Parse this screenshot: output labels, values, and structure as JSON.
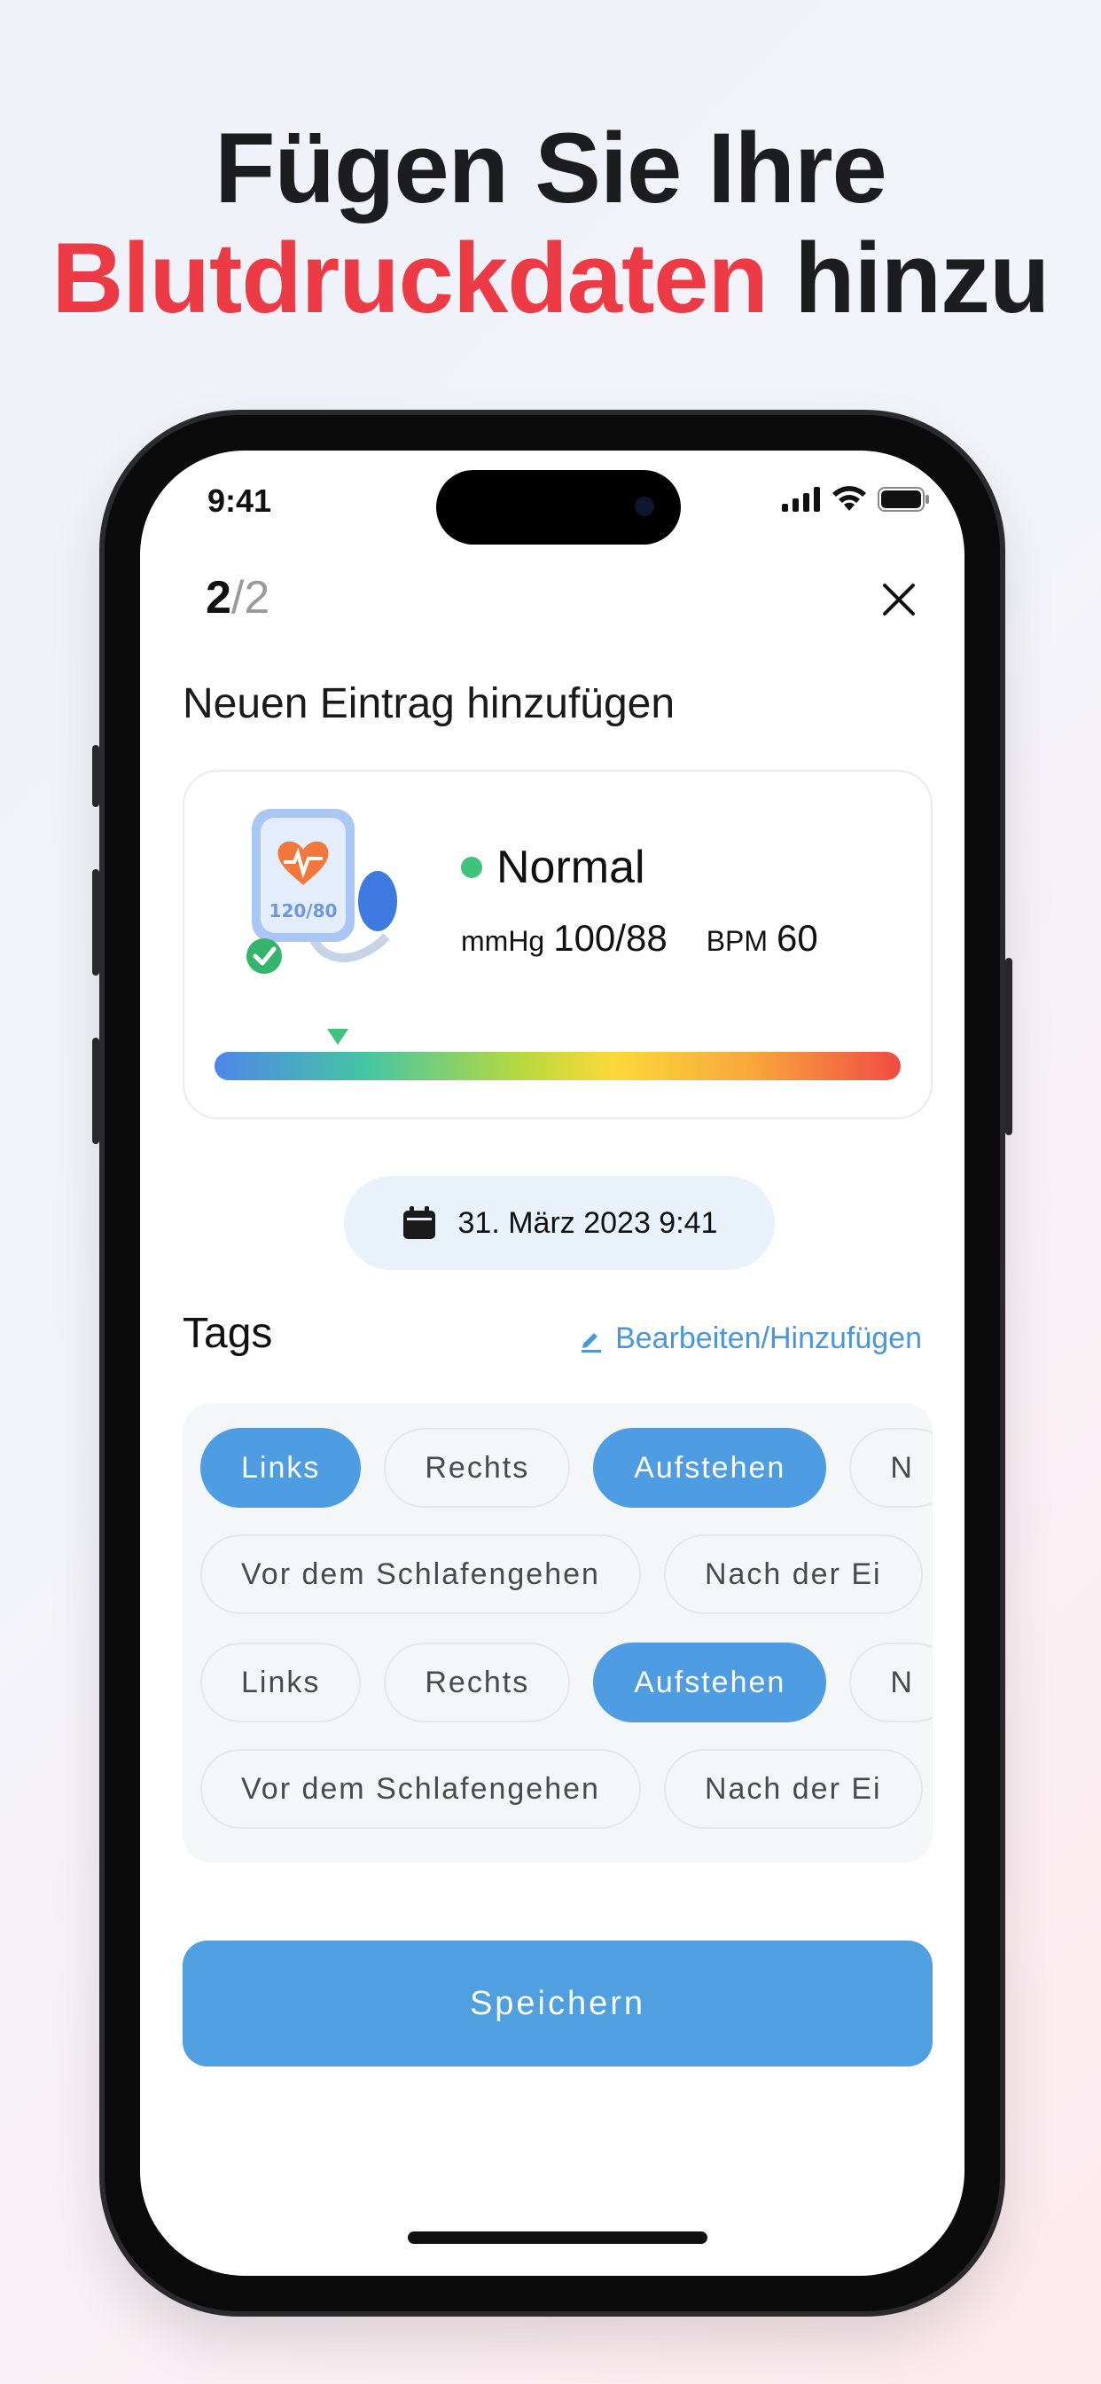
{
  "headline": {
    "line1": "Fügen Sie Ihre",
    "line2_accent": "Blutdruckdaten",
    "line2_rest": "hinzu"
  },
  "status_bar": {
    "time": "9:41"
  },
  "step": {
    "current": "2",
    "separator": "/",
    "total": "2"
  },
  "title": "Neuen Eintrag hinzufügen",
  "reading": {
    "status": "Normal",
    "pressure_unit": "mmHg",
    "pressure_value": "100/88",
    "pulse_unit": "BPM",
    "pulse_value": "60",
    "device_display": "120/80",
    "range_position": 0.18,
    "status_color": "#3fc47f"
  },
  "date": "31. März 2023 9:41",
  "tags": {
    "title": "Tags",
    "edit_label": "Bearbeiten/Hinzufügen",
    "rows": [
      [
        {
          "label": "Links",
          "selected": true
        },
        {
          "label": "Rechts",
          "selected": false
        },
        {
          "label": "Aufstehen",
          "selected": true
        },
        {
          "label": "N",
          "selected": false
        }
      ],
      [
        {
          "label": "Vor dem Schlafengehen",
          "selected": false
        },
        {
          "label": "Nach der Ei",
          "selected": false
        }
      ],
      [
        {
          "label": "Links",
          "selected": false
        },
        {
          "label": "Rechts",
          "selected": false
        },
        {
          "label": "Aufstehen",
          "selected": true
        },
        {
          "label": "N",
          "selected": false
        }
      ],
      [
        {
          "label": "Vor dem Schlafengehen",
          "selected": false
        },
        {
          "label": "Nach der Ei",
          "selected": false
        }
      ]
    ]
  },
  "save_label": "Speichern",
  "colors": {
    "accent_red": "#ec3b45",
    "primary_blue": "#509fe0",
    "tag_selected": "#4e9de2"
  }
}
